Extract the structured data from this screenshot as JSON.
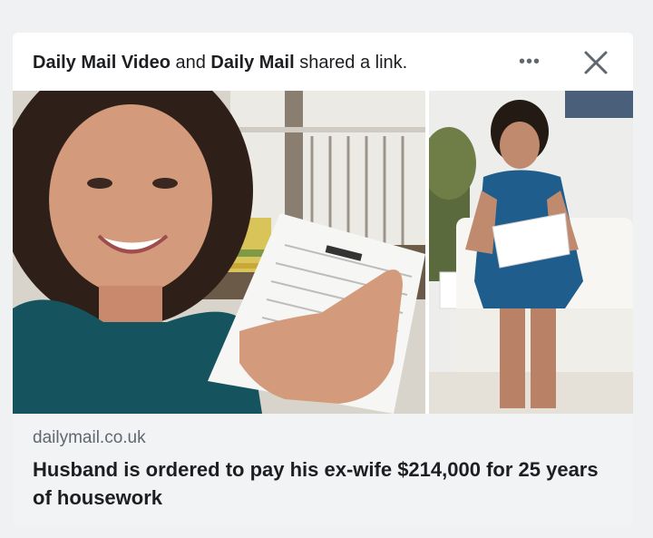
{
  "post": {
    "actor_1": "Daily Mail Video",
    "conjunction": "and",
    "actor_2": "Daily Mail",
    "action": "shared a link.",
    "more_label": "•••",
    "close_icon": "close-icon"
  },
  "link": {
    "domain": "dailymail.co.uk",
    "headline": "Husband is ordered to pay his ex-wife $214,000 for 25 years of housework"
  },
  "colors": {
    "accent_text": "#1c1e21",
    "secondary_text": "#606770",
    "link_background": "#f2f3f5"
  }
}
